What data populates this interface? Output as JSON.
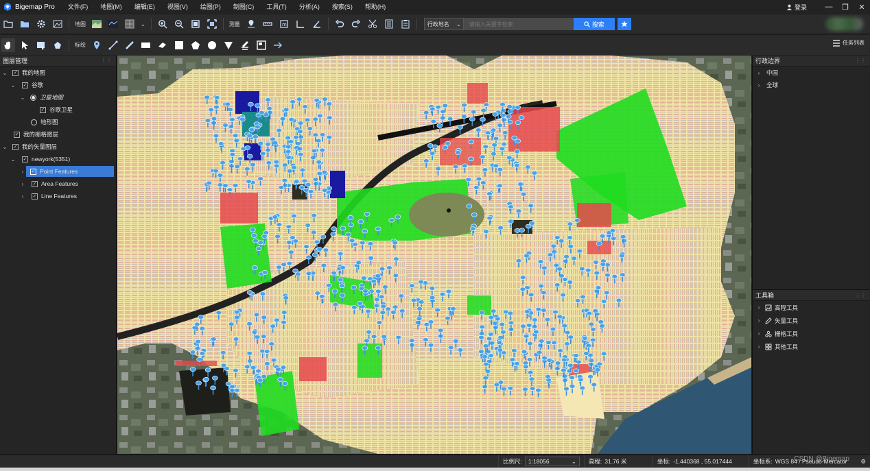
{
  "app": {
    "title": "Bigemap Pro"
  },
  "menu": [
    "文件(F)",
    "地图(M)",
    "编辑(E)",
    "视图(V)",
    "绘图(P)",
    "制图(C)",
    "工具(T)",
    "分析(A)",
    "搜索(S)",
    "帮助(H)"
  ],
  "user": {
    "login": "登录"
  },
  "toolbar1": {
    "map_label": "地图",
    "measure_label": "测量",
    "region_select": "行政地名",
    "search_placeholder": "请输入关键字检索",
    "search_button": "搜索"
  },
  "toolbar2": {
    "mark_label": "标绘",
    "task_list": "任务列表"
  },
  "layers": {
    "title": "图层管理",
    "items": [
      {
        "label": "我的地图",
        "checked": true
      },
      {
        "label": "谷歌",
        "checked": true
      },
      {
        "label": "卫星地图",
        "selected": true
      },
      {
        "label": "谷歌卫星",
        "checked": true
      },
      {
        "label": "地形图",
        "selected": false
      },
      {
        "label": "我的栅格图层",
        "checked": true
      },
      {
        "label": "我的矢量图层",
        "checked": true
      },
      {
        "label": "newyork(5351)",
        "checked": true
      },
      {
        "label": "Point Features",
        "checked": true
      },
      {
        "label": "Area Features",
        "checked": true
      },
      {
        "label": "Line Features",
        "checked": true
      }
    ]
  },
  "admin": {
    "title": "行政边界",
    "items": [
      "中国",
      "全球"
    ]
  },
  "toolbox": {
    "title": "工具箱",
    "items": [
      "高程工具",
      "矢量工具",
      "栅格工具",
      "其他工具"
    ]
  },
  "status": {
    "scale_label": "比例尺:",
    "scale_value": "1:18056",
    "elev_label": "高程:",
    "elev_value": "31.76 米",
    "coord_label": "坐标:",
    "coord_value": "-1.440368 , 55.017444",
    "crs_label": "坐标系:",
    "crs_value": "WGS 84 / Pseudo-Mercator",
    "watermark": "CSDN @Bigemap"
  },
  "colors": {
    "accent": "#2d7ff9",
    "selection": "#3a7bd5",
    "park_green": "#1fdc1f",
    "residential": "#efe3a6",
    "commercial": "#e6494c",
    "pin_blue": "#4aa3e6"
  }
}
